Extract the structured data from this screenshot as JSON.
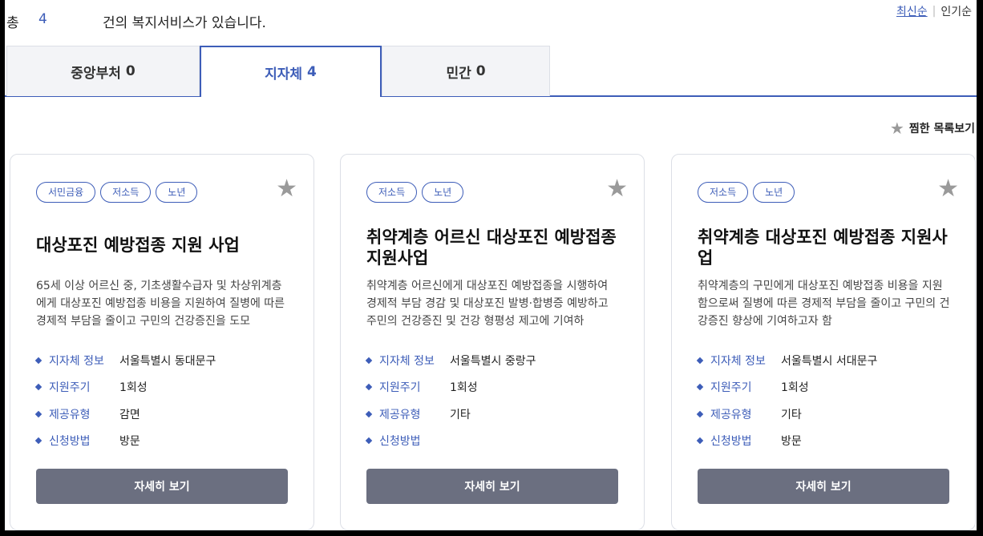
{
  "summary": {
    "total_label": "총",
    "total_count": "4",
    "suffix": "건의 복지서비스가 있습니다."
  },
  "sort": {
    "active": "최신순",
    "other": "인기순"
  },
  "tabs": [
    {
      "label": "중앙부처",
      "count": "0"
    },
    {
      "label": "지자체",
      "count": "4"
    },
    {
      "label": "민간",
      "count": "0"
    }
  ],
  "favorites_link": "찜한 목록보기",
  "info_labels": {
    "region": "지자체 정보",
    "cycle": "지원주기",
    "type": "제공유형",
    "method": "신청방법"
  },
  "detail_label": "자세히 보기",
  "cards": [
    {
      "tags": [
        "서민금융",
        "저소득",
        "노년"
      ],
      "title": "대상포진 예방접종 지원 사업",
      "desc": "65세 이상 어르신 중, 기초생활수급자 및 차상위계층에게 대상포진 예방접종 비용을 지원하여 질병에 따른 경제적 부담을 줄이고 구민의 건강증진을 도모",
      "region": "서울특별시 동대문구",
      "cycle": "1회성",
      "type": "감면",
      "method": "방문"
    },
    {
      "tags": [
        "저소득",
        "노년"
      ],
      "title": "취약계층 어르신 대상포진 예방접종 지원사업",
      "desc": "취약계층 어르신에게 대상포진 예방접종을 시행하여 경제적 부담 경감 및 대상포진 발병·합병증 예방하고 주민의 건강증진 및 건강 형평성 제고에 기여하",
      "region": "서울특별시 중랑구",
      "cycle": "1회성",
      "type": "기타",
      "method": ""
    },
    {
      "tags": [
        "저소득",
        "노년"
      ],
      "title": "취약계층 대상포진 예방접종 지원사업",
      "desc": "취약계층의 구민에게 대상포진 예방접종 비용을 지원함으로써 질병에 따른 경제적 부담을 줄이고 구민의 건강증진 향상에 기여하고자 함",
      "region": "서울특별시 서대문구",
      "cycle": "1회성",
      "type": "기타",
      "method": "방문"
    }
  ],
  "icons": {
    "star": "star-icon",
    "favorite": "star-icon"
  },
  "colors": {
    "accent": "#3d5db8",
    "button": "#6b6f80",
    "star": "#9a9a9a"
  }
}
